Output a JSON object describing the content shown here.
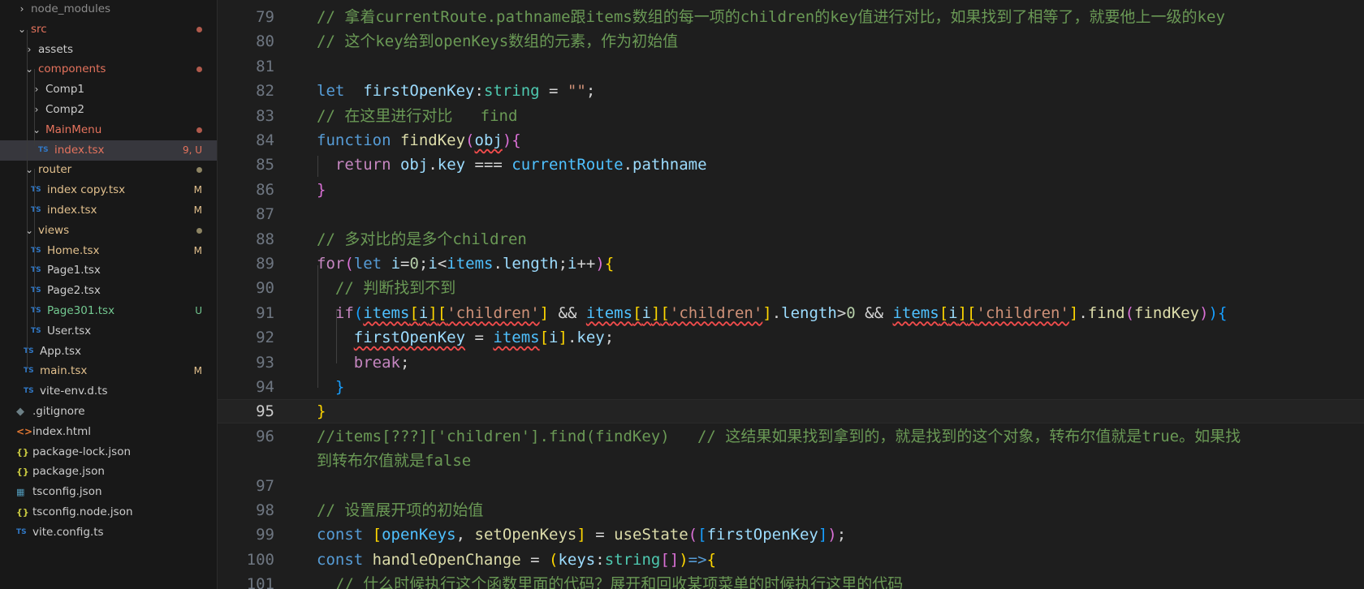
{
  "explorer": {
    "items": [
      {
        "label": "node_modules",
        "indent": 0,
        "type": "folder",
        "open": false,
        "color": "#8b8b8b",
        "badge": "",
        "dot": ""
      },
      {
        "label": "src",
        "indent": 0,
        "type": "folder",
        "open": true,
        "color": "#e5735d",
        "badge": "",
        "dot": "#b05a4c"
      },
      {
        "label": "assets",
        "indent": 1,
        "type": "folder",
        "open": false,
        "color": "#cccccc",
        "badge": "",
        "dot": ""
      },
      {
        "label": "components",
        "indent": 1,
        "type": "folder",
        "open": true,
        "color": "#e5735d",
        "badge": "",
        "dot": "#b05a4c"
      },
      {
        "label": "Comp1",
        "indent": 2,
        "type": "folder",
        "open": false,
        "color": "#cccccc",
        "badge": "",
        "dot": ""
      },
      {
        "label": "Comp2",
        "indent": 2,
        "type": "folder",
        "open": false,
        "color": "#cccccc",
        "badge": "",
        "dot": ""
      },
      {
        "label": "MainMenu",
        "indent": 2,
        "type": "folder",
        "open": true,
        "color": "#e5735d",
        "badge": "",
        "dot": "#b05a4c"
      },
      {
        "label": "index.tsx",
        "indent": 3,
        "type": "ts",
        "color": "#e5735d",
        "badge": "9, U",
        "badgeColor": "#e5735d",
        "dot": "",
        "selected": true
      },
      {
        "label": "router",
        "indent": 1,
        "type": "folder",
        "open": true,
        "color": "#e2c08d",
        "badge": "",
        "dot": "#8d8463"
      },
      {
        "label": "index copy.tsx",
        "indent": 2,
        "type": "ts",
        "color": "#e2c08d",
        "badge": "M",
        "badgeColor": "#e2c08d",
        "dot": ""
      },
      {
        "label": "index.tsx",
        "indent": 2,
        "type": "ts",
        "color": "#e2c08d",
        "badge": "M",
        "badgeColor": "#e2c08d",
        "dot": ""
      },
      {
        "label": "views",
        "indent": 1,
        "type": "folder",
        "open": true,
        "color": "#e2c08d",
        "badge": "",
        "dot": "#8d8463"
      },
      {
        "label": "Home.tsx",
        "indent": 2,
        "type": "ts",
        "color": "#e2c08d",
        "badge": "M",
        "badgeColor": "#e2c08d",
        "dot": ""
      },
      {
        "label": "Page1.tsx",
        "indent": 2,
        "type": "ts",
        "color": "#cccccc",
        "badge": "",
        "dot": ""
      },
      {
        "label": "Page2.tsx",
        "indent": 2,
        "type": "ts",
        "color": "#cccccc",
        "badge": "",
        "dot": ""
      },
      {
        "label": "Page301.tsx",
        "indent": 2,
        "type": "ts",
        "color": "#73c991",
        "badge": "U",
        "badgeColor": "#73c991",
        "dot": ""
      },
      {
        "label": "User.tsx",
        "indent": 2,
        "type": "ts",
        "color": "#cccccc",
        "badge": "",
        "dot": ""
      },
      {
        "label": "App.tsx",
        "indent": 1,
        "type": "ts",
        "color": "#cccccc",
        "badge": "",
        "dot": ""
      },
      {
        "label": "main.tsx",
        "indent": 1,
        "type": "ts",
        "color": "#e2c08d",
        "badge": "M",
        "badgeColor": "#e2c08d",
        "dot": ""
      },
      {
        "label": "vite-env.d.ts",
        "indent": 1,
        "type": "ts",
        "color": "#cccccc",
        "badge": "",
        "dot": ""
      },
      {
        "label": ".gitignore",
        "indent": 0,
        "type": "git",
        "color": "#cccccc",
        "badge": "",
        "dot": ""
      },
      {
        "label": "index.html",
        "indent": 0,
        "type": "html",
        "color": "#cccccc",
        "badge": "",
        "dot": ""
      },
      {
        "label": "package-lock.json",
        "indent": 0,
        "type": "json",
        "color": "#cccccc",
        "badge": "",
        "dot": ""
      },
      {
        "label": "package.json",
        "indent": 0,
        "type": "json",
        "color": "#cccccc",
        "badge": "",
        "dot": ""
      },
      {
        "label": "tsconfig.json",
        "indent": 0,
        "type": "tsconf",
        "color": "#cccccc",
        "badge": "",
        "dot": ""
      },
      {
        "label": "tsconfig.node.json",
        "indent": 0,
        "type": "json",
        "color": "#cccccc",
        "badge": "",
        "dot": ""
      },
      {
        "label": "vite.config.ts",
        "indent": 0,
        "type": "ts",
        "color": "#cccccc",
        "badge": "",
        "dot": ""
      }
    ]
  },
  "editor": {
    "current_line": "95",
    "lines": [
      {
        "n": "79",
        "t": [
          [
            "cm",
            "// 拿着currentRoute.pathname跟items数组的每一项的children的key值进行对比，如果找到了相等了，就要他上一级的key"
          ]
        ]
      },
      {
        "n": "80",
        "t": [
          [
            "cm",
            "// 这个key给到openKeys数组的元素，作为初始值"
          ]
        ]
      },
      {
        "n": "81",
        "t": []
      },
      {
        "n": "82",
        "t": [
          [
            "kw",
            "let"
          ],
          [
            "",
            "  "
          ],
          [
            "var",
            "firstOpenKey"
          ],
          [
            "",
            ":"
          ],
          [
            "ty",
            "string"
          ],
          [
            "",
            " = "
          ],
          [
            "str",
            "\"\""
          ],
          [
            "",
            ";"
          ]
        ]
      },
      {
        "n": "83",
        "t": [
          [
            "cm",
            "// 在这里进行对比   find"
          ]
        ]
      },
      {
        "n": "84",
        "t": [
          [
            "kw",
            "function"
          ],
          [
            "",
            " "
          ],
          [
            "fn",
            "findKey"
          ],
          [
            "b2",
            "("
          ],
          [
            "var sq",
            "obj"
          ],
          [
            "b2",
            ")"
          ],
          [
            "b2",
            "{"
          ]
        ]
      },
      {
        "n": "85",
        "t": [
          [
            "",
            "  "
          ],
          [
            "ctl",
            "return"
          ],
          [
            "",
            " "
          ],
          [
            "var",
            "obj"
          ],
          [
            "",
            "."
          ],
          [
            "var",
            "key"
          ],
          [
            "",
            " === "
          ],
          [
            "cst",
            "currentRoute"
          ],
          [
            "",
            "."
          ],
          [
            "var",
            "pathname"
          ]
        ]
      },
      {
        "n": "86",
        "t": [
          [
            "b2",
            "}"
          ]
        ]
      },
      {
        "n": "87",
        "t": []
      },
      {
        "n": "88",
        "t": [
          [
            "cm",
            "// 多对比的是多个children"
          ]
        ]
      },
      {
        "n": "89",
        "t": [
          [
            "ctl",
            "for"
          ],
          [
            "b2",
            "("
          ],
          [
            "kw",
            "let"
          ],
          [
            "",
            " "
          ],
          [
            "var",
            "i"
          ],
          [
            "",
            "="
          ],
          [
            "num",
            "0"
          ],
          [
            "",
            ";"
          ],
          [
            "var",
            "i"
          ],
          [
            "",
            "<"
          ],
          [
            "cst",
            "items"
          ],
          [
            "",
            "."
          ],
          [
            "var",
            "length"
          ],
          [
            "",
            ";"
          ],
          [
            "var",
            "i"
          ],
          [
            "",
            "++"
          ],
          [
            "b2",
            ")"
          ],
          [
            "b1",
            "{"
          ]
        ]
      },
      {
        "n": "90",
        "t": [
          [
            "",
            "  "
          ],
          [
            "cm",
            "// 判断找到不到"
          ]
        ]
      },
      {
        "n": "91",
        "t": [
          [
            "",
            "  "
          ],
          [
            "ctl",
            "if"
          ],
          [
            "b3",
            "("
          ],
          [
            "cst sq",
            "items"
          ],
          [
            "b1 sq",
            "["
          ],
          [
            "var sq",
            "i"
          ],
          [
            "b1 sq",
            "]"
          ],
          [
            "b1 sq",
            "["
          ],
          [
            "str sq",
            "'children'"
          ],
          [
            "b1",
            "]"
          ],
          [
            "",
            " && "
          ],
          [
            "cst sq",
            "items"
          ],
          [
            "b1 sq",
            "["
          ],
          [
            "var sq",
            "i"
          ],
          [
            "b1 sq",
            "]"
          ],
          [
            "b1 sq",
            "["
          ],
          [
            "str sq",
            "'children'"
          ],
          [
            "b1",
            "]"
          ],
          [
            "",
            "."
          ],
          [
            "var",
            "length"
          ],
          [
            "",
            ">"
          ],
          [
            "num",
            "0"
          ],
          [
            "",
            " && "
          ],
          [
            "cst sq",
            "items"
          ],
          [
            "b1 sq",
            "["
          ],
          [
            "var sq",
            "i"
          ],
          [
            "b1 sq",
            "]"
          ],
          [
            "b1 sq",
            "["
          ],
          [
            "str sq",
            "'children'"
          ],
          [
            "b1",
            "]"
          ],
          [
            "",
            "."
          ],
          [
            "fn",
            "find"
          ],
          [
            "b2",
            "("
          ],
          [
            "fn",
            "findKey"
          ],
          [
            "b2",
            ")"
          ],
          [
            "b3",
            ")"
          ],
          [
            "b3",
            "{"
          ]
        ]
      },
      {
        "n": "92",
        "t": [
          [
            "",
            "    "
          ],
          [
            "var sq",
            "firstOpenKey"
          ],
          [
            "",
            " = "
          ],
          [
            "cst sq",
            "items"
          ],
          [
            "b1",
            "["
          ],
          [
            "var",
            "i"
          ],
          [
            "b1",
            "]"
          ],
          [
            "",
            "."
          ],
          [
            "var",
            "key"
          ],
          [
            "",
            ";"
          ]
        ]
      },
      {
        "n": "93",
        "t": [
          [
            "",
            "    "
          ],
          [
            "ctl",
            "break"
          ],
          [
            "",
            ";"
          ]
        ]
      },
      {
        "n": "94",
        "t": [
          [
            "",
            "  "
          ],
          [
            "b3",
            "}"
          ]
        ]
      },
      {
        "n": "95",
        "t": [
          [
            "b1",
            "}"
          ]
        ]
      },
      {
        "n": "96",
        "t": [
          [
            "cm",
            "//items[???]['children'].find(findKey)   // 这结果如果找到拿到的，就是找到的这个对象，转布尔值就是true。如果找"
          ]
        ]
      },
      {
        "n": "",
        "t": [
          [
            "cm",
            "到转布尔值就是false"
          ]
        ]
      },
      {
        "n": "97",
        "t": []
      },
      {
        "n": "98",
        "t": [
          [
            "cm",
            "// 设置展开项的初始值"
          ]
        ]
      },
      {
        "n": "99",
        "t": [
          [
            "kw",
            "const"
          ],
          [
            "",
            " "
          ],
          [
            "b1",
            "["
          ],
          [
            "cst",
            "openKeys"
          ],
          [
            "",
            ", "
          ],
          [
            "fn",
            "setOpenKeys"
          ],
          [
            "b1",
            "]"
          ],
          [
            "",
            " = "
          ],
          [
            "fn",
            "useState"
          ],
          [
            "b2",
            "("
          ],
          [
            "b3",
            "["
          ],
          [
            "var",
            "firstOpenKey"
          ],
          [
            "b3",
            "]"
          ],
          [
            "b2",
            ")"
          ],
          [
            "",
            ";"
          ]
        ]
      },
      {
        "n": "100",
        "t": [
          [
            "kw",
            "const"
          ],
          [
            "",
            " "
          ],
          [
            "fn",
            "handleOpenChange"
          ],
          [
            "",
            " = "
          ],
          [
            "b1",
            "("
          ],
          [
            "var",
            "keys"
          ],
          [
            "",
            ":"
          ],
          [
            "ty",
            "string"
          ],
          [
            "b2",
            "[]"
          ],
          [
            "b1",
            ")"
          ],
          [
            "kw",
            "=>"
          ],
          [
            "b1",
            "{"
          ]
        ]
      },
      {
        "n": "101",
        "t": [
          [
            "",
            "  "
          ],
          [
            "cm",
            "// 什么时候执行这个函数里面的代码？展开和回收某项菜单的时候执行这里的代码"
          ]
        ]
      }
    ]
  }
}
